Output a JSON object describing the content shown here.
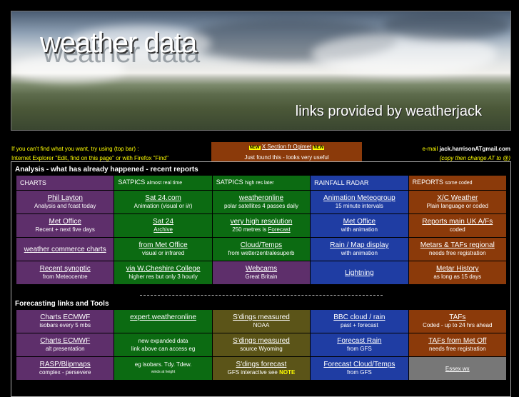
{
  "banner": {
    "title": "weather data",
    "title_echo": "weather data",
    "subtitle": "links provided by weatherjack"
  },
  "top": {
    "left_line1": "If you can't find what you want, try using (top bar) :",
    "left_line2": "Internet Explorer \"Edit, find on this page\"  or with Firefox \"Find\"",
    "notice_new_badge": "NEW",
    "notice_title": "X Section fr Ogimet",
    "notice_subtitle": "Just found this - looks very useful",
    "email_label": "e-mail",
    "email_address": "jack.harrisonATgmail.com",
    "email_hint": "(copy then change AT to @)"
  },
  "analysis": {
    "heading": "Analysis  - what has already happened - recent reports",
    "headers": [
      "CHARTS",
      "SATPICS",
      "SATPICS",
      "RAINFALL RADAR",
      "REPORTS"
    ],
    "header_notes": [
      "",
      "almost real time",
      "high res later",
      "",
      "some coded"
    ],
    "rows": [
      [
        {
          "link": "Phil Layton",
          "desc": "Analysis and fcast today"
        },
        {
          "link": "Sat 24.com",
          "desc": "Animation (visual or i/r)"
        },
        {
          "link": "weatheronline",
          "desc": "polar satellites 4 passes daily"
        },
        {
          "link": "Animation Meteogroup",
          "desc": "15 minute intervals"
        },
        {
          "link": "X/C Weather",
          "desc": "Plain language or coded"
        }
      ],
      [
        {
          "link": "Met Office",
          "desc": "Recent + next five days"
        },
        {
          "link": "Sat 24",
          "desc": "Archive"
        },
        {
          "link": "very high resolution",
          "desc": "250 metres is",
          "desc_link": "Forecast"
        },
        {
          "link": "Met Office",
          "desc": "with animation"
        },
        {
          "link": "Reports main UK A/Fs",
          "desc": "coded"
        }
      ],
      [
        {
          "link": "weather commerce charts",
          "desc": ""
        },
        {
          "link": "from Met Office",
          "desc": "visual or infrared"
        },
        {
          "link": "Cloud/Temps",
          "desc": "from wetterzentralesuperb"
        },
        {
          "link": "Rain / Map display",
          "desc": "with animation"
        },
        {
          "link": "Metars & TAFs regional",
          "desc": "needs free registration"
        }
      ],
      [
        {
          "link": "Recent synoptic",
          "desc": "from Meteocentre"
        },
        {
          "link": "via W.Cheshire College",
          "desc": "higher res but only 3 hourly"
        },
        {
          "link": "Webcams",
          "desc": "Great Britain"
        },
        {
          "link": "Lightning",
          "desc": ""
        },
        {
          "link": "Metar History",
          "desc": "as long as 15 days"
        }
      ]
    ]
  },
  "forecasting": {
    "heading": "Forecasting links and Tools",
    "rows": [
      [
        {
          "link": "Charts ECMWF",
          "desc": "isobars every 5 mbs"
        },
        {
          "link": "expert.weatheronline",
          "desc": ""
        },
        {
          "link": "S'dings measured",
          "desc": "NOAA"
        },
        {
          "link": "BBC cloud / rain",
          "desc": "past + forecast"
        },
        {
          "link": "TAFs",
          "desc": "Coded - up to 24 hrs ahead"
        }
      ],
      [
        {
          "link": "Charts ECMWF",
          "desc": "alt presentation"
        },
        {
          "link": "",
          "desc": "new expanded data",
          "desc2": "link above can access eg"
        },
        {
          "link": "S'dings measured",
          "desc": "source Wyoming"
        },
        {
          "link": "Forecast Rain",
          "desc": "from GFS"
        },
        {
          "link": "TAFs from Met Off",
          "desc": "needs free registration"
        }
      ],
      [
        {
          "link": "RASP/Blipmaps",
          "desc": "complex - persevere"
        },
        {
          "link": "",
          "desc": "eg isobars. Tdy. Tdew.",
          "desc2": "winds at height"
        },
        {
          "link": "S'dings forecast",
          "desc": "GFS interactive see",
          "desc_note": "NOTE"
        },
        {
          "link": "Forecast Cloud/Temps",
          "desc": "from GFS"
        },
        {
          "link": "Essex wx",
          "desc": ""
        }
      ]
    ]
  },
  "colors": {
    "purple": "#5e2f6b",
    "green": "#0c6b12",
    "blue": "#1f3da3",
    "rust": "#8b3a0a",
    "olive": "#5b5418",
    "grey": "#777777",
    "highlight": "#ffff00"
  }
}
